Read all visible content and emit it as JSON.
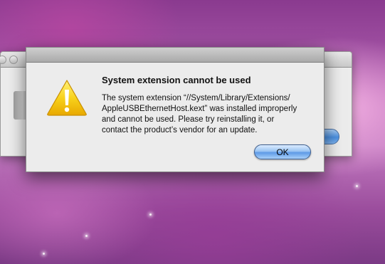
{
  "alert": {
    "title": "System extension cannot be used",
    "message": "The system extension “//System/Library/Extensions/\nAppleUSBEthernetHost.kext” was installed improperly\nand cannot be used. Please try reinstalling it, or\ncontact the product’s vendor for an update.",
    "icon": "warning-triangle-icon",
    "ok_label": "OK"
  },
  "colors": {
    "desktop_accent": "#b060b0",
    "default_button": "#5e9ae6",
    "warning_yellow": "#f5c400"
  }
}
